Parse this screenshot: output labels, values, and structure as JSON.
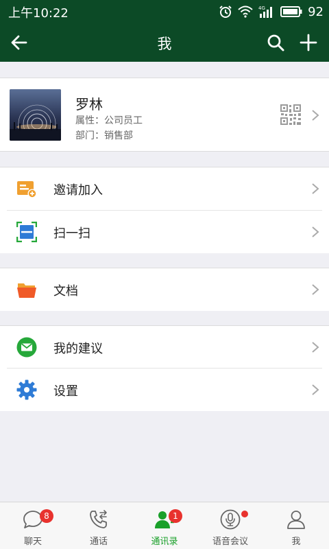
{
  "status_bar": {
    "time": "上午10:22",
    "battery": "92",
    "network": "4G",
    "icons": [
      "alarm-icon",
      "wifi-icon",
      "signal-icon",
      "battery-icon"
    ]
  },
  "header": {
    "title": "我",
    "icons": [
      "back-arrow-icon",
      "search-icon",
      "plus-icon"
    ]
  },
  "profile": {
    "name": "罗林",
    "attribute": "属性：公司员工",
    "department": "部门：销售部"
  },
  "menu": [
    {
      "label": "邀请加入",
      "icon": "invite-icon",
      "color": "#f0a030"
    },
    {
      "label": "扫一扫",
      "icon": "scan-icon",
      "color": "#2e7bd6"
    },
    {
      "label": "文档",
      "icon": "folder-icon",
      "color": "#f05a28"
    },
    {
      "label": "我的建议",
      "icon": "mail-icon",
      "color": "#26a83a"
    },
    {
      "label": "设置",
      "icon": "gear-icon",
      "color": "#2e7bd6"
    }
  ],
  "tabs": [
    {
      "label": "聊天",
      "icon": "chat-icon",
      "badge": "8",
      "active": false
    },
    {
      "label": "通话",
      "icon": "call-icon",
      "active": false
    },
    {
      "label": "通讯录",
      "icon": "contacts-icon",
      "badge": "1",
      "active": true
    },
    {
      "label": "语音会议",
      "icon": "mic-icon",
      "dot": true,
      "active": false
    },
    {
      "label": "我",
      "icon": "person-icon",
      "active": false
    }
  ],
  "colors": {
    "header_bg": "#0c4a26",
    "active_tab": "#1aa02a",
    "badge": "#e8322e",
    "page_bg": "#efeff4"
  }
}
